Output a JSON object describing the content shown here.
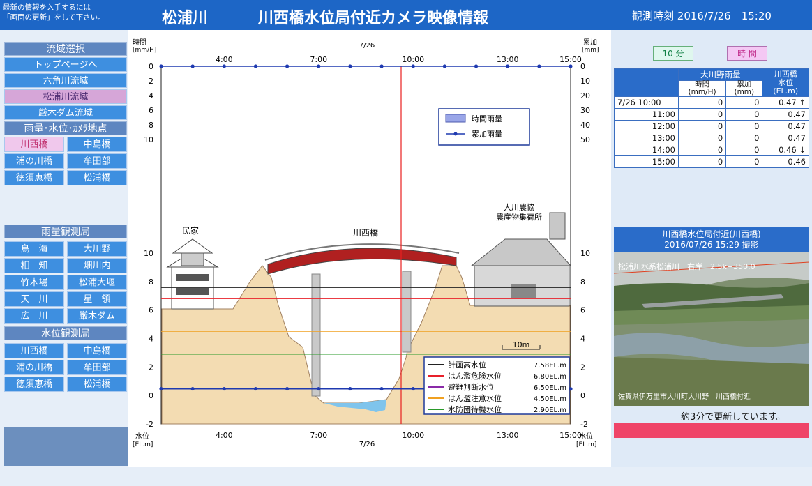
{
  "header": {
    "refresh_note_1": "最新の情報を入手するには",
    "refresh_note_2": "「画面の更新」をして下さい。",
    "river_name": "松浦川",
    "title": "川西橋水位局付近カメラ映像情報",
    "obs_time_label": "観測時刻",
    "obs_time_value": "2016/7/26　15:20"
  },
  "sidebar": {
    "basin_header": "流域選択",
    "basin_items": [
      "トップページへ",
      "六角川流域",
      "松浦川流域",
      "厳木ダム流域"
    ],
    "basin_active_index": 2,
    "point_header": "雨量･水位･ｶﾒﾗ地点",
    "point_items": [
      [
        "川西橋",
        "中島橋"
      ],
      [
        "浦の川橋",
        "牟田部"
      ],
      [
        "徳須恵橋",
        "松浦橋"
      ]
    ],
    "rain_header": "雨量観測局",
    "rain_items": [
      [
        "鳥　海",
        "大川野"
      ],
      [
        "相　知",
        "畑川内"
      ],
      [
        "竹木場",
        "松浦大堰"
      ],
      [
        "天　川",
        "星　領"
      ],
      [
        "広　川",
        "厳木ダム"
      ]
    ],
    "level_header": "水位観測局",
    "level_items": [
      [
        "川西橋",
        "中島橋"
      ],
      [
        "浦の川橋",
        "牟田部"
      ],
      [
        "徳須恵橋",
        "松浦橋"
      ]
    ]
  },
  "chart": {
    "top_left_axis_title": "時間",
    "top_left_axis_unit": "[mm/H]",
    "top_right_axis_title": "累加",
    "top_right_axis_unit": "[mm]",
    "bottom_left_axis_title": "水位",
    "bottom_left_axis_unit": "[EL.m]",
    "bottom_right_axis_title": "水位",
    "bottom_right_axis_unit": "[EL.m]",
    "date_label": "7/26",
    "legend_hourly": "時間雨量",
    "legend_cumulative": "累加雨量",
    "house_label": "民家",
    "bridge_label": "川西橋",
    "building_label_1": "大川農協",
    "building_label_2": "農産物集荷所",
    "scale_label": "10m",
    "level_legend": [
      {
        "name": "計画高水位",
        "value": "7.58EL.m",
        "color": "#222222",
        "level": 7.58
      },
      {
        "name": "はん濫危険水位",
        "value": "6.80EL.m",
        "color": "#e8202a",
        "level": 6.8
      },
      {
        "name": "避難判断水位",
        "value": "6.50EL.m",
        "color": "#8a2aa8",
        "level": 6.5
      },
      {
        "name": "はん濫注意水位",
        "value": "4.50EL.m",
        "color": "#f0a020",
        "level": 4.5
      },
      {
        "name": "水防団待機水位",
        "value": "2.90EL.m",
        "color": "#2a9a2a",
        "level": 2.9
      }
    ]
  },
  "chart_data": [
    {
      "type": "line",
      "title": "",
      "xlabel": "",
      "ylabel": "累加 [mm]",
      "x": [
        "4:00",
        "7:00",
        "10:00",
        "13:00",
        "15:00"
      ],
      "x_range": [
        "2:00",
        "15:00"
      ],
      "ylim": [
        0,
        50
      ],
      "y_ticks_left": [
        0,
        2,
        4,
        6,
        8,
        10
      ],
      "y_ticks_right": [
        0,
        10,
        20,
        30,
        40,
        50
      ],
      "series": [
        {
          "name": "時間雨量",
          "values": [
            0,
            0,
            0,
            0,
            0,
            0,
            0,
            0,
            0,
            0,
            0,
            0,
            0,
            0
          ]
        },
        {
          "name": "累加雨量",
          "values": [
            0,
            0,
            0,
            0,
            0,
            0,
            0,
            0,
            0,
            0,
            0,
            0,
            0,
            0
          ]
        }
      ]
    },
    {
      "type": "line",
      "title": "",
      "xlabel": "",
      "ylabel": "水位 [EL.m]",
      "x": [
        "4:00",
        "7:00",
        "10:00",
        "13:00",
        "15:00"
      ],
      "x_range": [
        "2:00",
        "15:00"
      ],
      "ylim": [
        -2,
        10
      ],
      "y_ticks": [
        -2,
        0,
        2,
        4,
        6,
        8,
        10
      ],
      "series": [
        {
          "name": "水位",
          "values": [
            0.47,
            0.47,
            0.47,
            0.47,
            0.47,
            0.47,
            0.47,
            0.47,
            0.47,
            0.47,
            0.47,
            0.47,
            0.47,
            0.46
          ]
        }
      ]
    }
  ],
  "right_panel": {
    "toggle_10min": "10 分",
    "toggle_hourly": "時 間",
    "table_header_station": "大川野雨量",
    "table_header_level_1": "川西橋",
    "table_header_level_2": "水位",
    "table_header_level_3": "(EL.m)",
    "table_header_hourly_1": "時間",
    "table_header_hourly_2": "(mm/H)",
    "table_header_cum_1": "累加",
    "table_header_cum_2": "(mm)",
    "rows": [
      {
        "time": "7/26  10:00",
        "hourly": "0",
        "cum": "0",
        "level": "0.47 ↑"
      },
      {
        "time": "11:00",
        "hourly": "0",
        "cum": "0",
        "level": "0.47"
      },
      {
        "time": "12:00",
        "hourly": "0",
        "cum": "0",
        "level": "0.47"
      },
      {
        "time": "13:00",
        "hourly": "0",
        "cum": "0",
        "level": "0.47"
      },
      {
        "time": "14:00",
        "hourly": "0",
        "cum": "0",
        "level": "0.46 ↓"
      },
      {
        "time": "15:00",
        "hourly": "0",
        "cum": "0",
        "level": "0.46"
      }
    ],
    "camera_title_1": "川西橋水位局付近(川西橋)",
    "camera_title_2": "2016/07/26 15:29 撮影",
    "camera_overlay_top": "松浦川水系松浦川　右岸　2.5k+350.0",
    "camera_overlay_bottom": "佐賀県伊万里市大川町大川野　川西橋付近",
    "update_note": "約3分で更新しています。",
    "alert_color": "#ef4468"
  }
}
